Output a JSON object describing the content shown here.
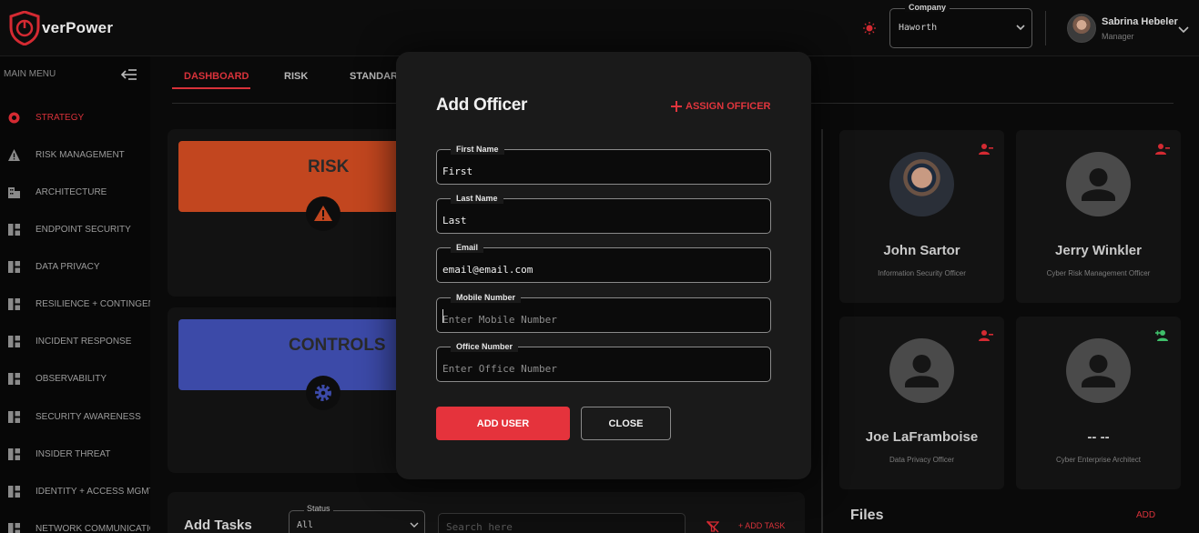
{
  "app": {
    "logo_text": "verPower"
  },
  "header": {
    "company_label": "Company",
    "company_value": "Haworth",
    "user_name": "Sabrina Hebeler",
    "user_role": "Manager"
  },
  "sidebar": {
    "menu_label": "MAIN MENU",
    "items": [
      {
        "label": "STRATEGY",
        "icon": "shield-icon",
        "active": true
      },
      {
        "label": "RISK MANAGEMENT",
        "icon": "warning-icon"
      },
      {
        "label": "ARCHITECTURE",
        "icon": "building-icon"
      },
      {
        "label": "ENDPOINT SECURITY",
        "icon": "grid-icon"
      },
      {
        "label": "DATA PRIVACY",
        "icon": "grid-icon"
      },
      {
        "label": "RESILIENCE + CONTINGENCY",
        "icon": "grid-icon"
      },
      {
        "label": "INCIDENT RESPONSE",
        "icon": "grid-icon"
      },
      {
        "label": "OBSERVABILITY",
        "icon": "grid-icon"
      },
      {
        "label": "SECURITY AWARENESS",
        "icon": "grid-icon"
      },
      {
        "label": "INSIDER THREAT",
        "icon": "grid-icon"
      },
      {
        "label": "IDENTITY + ACCESS MGMT",
        "icon": "grid-icon"
      },
      {
        "label": "NETWORK COMMUNICATION",
        "icon": "grid-icon"
      }
    ]
  },
  "tabs": [
    {
      "label": "DASHBOARD",
      "active": true
    },
    {
      "label": "RISK"
    },
    {
      "label": "STANDARDS"
    }
  ],
  "tiles": {
    "risk": {
      "title": "RISK",
      "color": "#c2461f"
    },
    "controls": {
      "title": "CONTROLS",
      "color": "#3c4aa8"
    }
  },
  "tasks": {
    "title": "Add Tasks",
    "status_label": "Status",
    "status_value": "All",
    "search_placeholder": "Search here",
    "add_task_label": "+ ADD TASK"
  },
  "officers": [
    {
      "name": "John Sartor",
      "title": "Information Security Officer",
      "has_photo": true,
      "action": "remove-user-icon"
    },
    {
      "name": "Jerry Winkler",
      "title": "Cyber Risk Management Officer",
      "has_photo": false,
      "action": "remove-user-icon"
    },
    {
      "name": "Joe LaFramboise",
      "title": "Data Privacy Officer",
      "has_photo": false,
      "action": "remove-user-icon"
    },
    {
      "name": "-- --",
      "title": "Cyber Enterprise Architect",
      "has_photo": false,
      "action": "add-user-icon"
    }
  ],
  "files": {
    "title": "Files",
    "add_label": "ADD"
  },
  "modal": {
    "title": "Add Officer",
    "assign_label": "ASSIGN OFFICER",
    "fields": {
      "first_name": {
        "label": "First Name",
        "value": "First",
        "placeholder": ""
      },
      "last_name": {
        "label": "Last Name",
        "value": "Last",
        "placeholder": ""
      },
      "email": {
        "label": "Email",
        "value": "email@email.com",
        "placeholder": ""
      },
      "mobile": {
        "label": "Mobile Number",
        "value": "",
        "placeholder": "Enter Mobile Number"
      },
      "office": {
        "label": "Office Number",
        "value": "",
        "placeholder": "Enter Office Number"
      }
    },
    "add_user_label": "ADD USER",
    "close_label": "CLOSE"
  },
  "colors": {
    "accent": "#e5333c",
    "add_green": "#3fbf6a"
  }
}
